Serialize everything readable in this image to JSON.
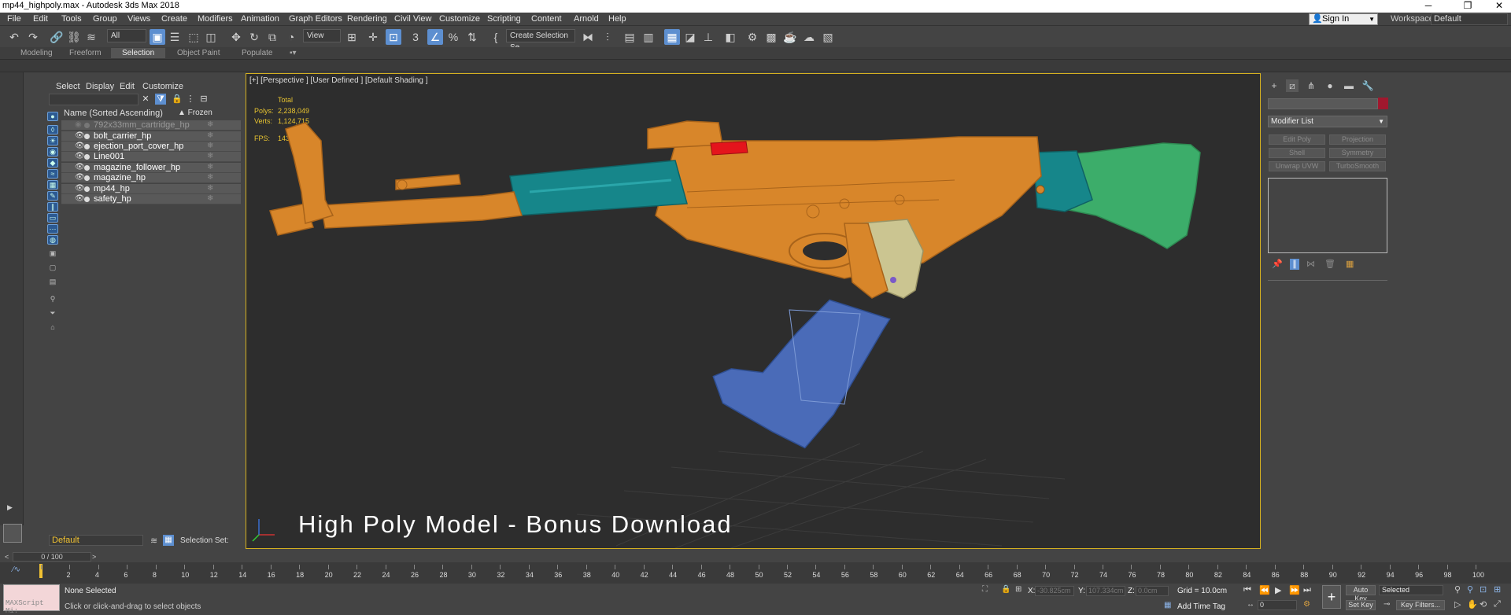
{
  "app": {
    "window_title": "mp44_highpoly.max - Autodesk 3ds Max 2018",
    "window_buttons": [
      "─",
      "❐",
      "✕"
    ]
  },
  "menus": [
    "File",
    "Edit",
    "Tools",
    "Group",
    "Views",
    "Create",
    "Modifiers",
    "Animation",
    "Graph Editors",
    "Rendering",
    "Civil View",
    "Customize",
    "Scripting",
    "Content",
    "Arnold",
    "Help"
  ],
  "account": {
    "sign_in": "Sign In",
    "workspaces_label": "Workspaces:",
    "workspace": "Default"
  },
  "toolbar": {
    "filter": "All",
    "ref_coord": "View",
    "selection_set": "Create Selection Se"
  },
  "ribbon_tabs": [
    "Modeling",
    "Freeform",
    "Selection",
    "Object Paint",
    "Populate"
  ],
  "scene_explorer": {
    "menus": [
      "Select",
      "Display",
      "Edit",
      "Customize"
    ],
    "col_name": "Name (Sorted Ascending)",
    "col_frozen": "▲ Frozen",
    "rows": [
      {
        "name": "792x33mm_cartridge_hp",
        "hidden": true
      },
      {
        "name": "bolt_carrier_hp",
        "hidden": false
      },
      {
        "name": "ejection_port_cover_hp",
        "hidden": false
      },
      {
        "name": "Line001",
        "hidden": false
      },
      {
        "name": "magazine_follower_hp",
        "hidden": false
      },
      {
        "name": "magazine_hp",
        "hidden": false
      },
      {
        "name": "mp44_hp",
        "hidden": false
      },
      {
        "name": "safety_hp",
        "hidden": false
      }
    ],
    "layer": "Default",
    "selection_set_label": "Selection Set:"
  },
  "viewport": {
    "label": "[+] [Perspective ] [User Defined ] [Default Shading ]",
    "stats_total": "Total",
    "polys_label": "Polys:",
    "polys": "2,238,049",
    "verts_label": "Verts:",
    "verts": "1,124,715",
    "fps_label": "FPS:",
    "fps": "143.036",
    "caption": "High Poly Model - Bonus Download",
    "colors": {
      "body": "#d8862a",
      "teal": "#16868a",
      "stock": "#3cad6a",
      "magazine": "#4a6bb8",
      "grip": "#cbc591",
      "red": "#e4141c"
    }
  },
  "command_panel": {
    "modifier_list": "Modifier List",
    "buttons": [
      "Edit Poly",
      "Projection",
      "Shell",
      "Symmetry",
      "Unwrap UVW",
      "TurboSmooth"
    ]
  },
  "timeline": {
    "slider": "0 / 100",
    "ticks": [
      "0",
      "2",
      "4",
      "6",
      "8",
      "10",
      "12",
      "14",
      "16",
      "18",
      "20",
      "22",
      "24",
      "26",
      "28",
      "30",
      "32",
      "34",
      "36",
      "38",
      "40",
      "42",
      "44",
      "46",
      "48",
      "50",
      "52",
      "54",
      "56",
      "58",
      "60",
      "62",
      "64",
      "66",
      "68",
      "70",
      "72",
      "74",
      "76",
      "78",
      "80",
      "82",
      "84",
      "86",
      "88",
      "90",
      "92",
      "94",
      "96",
      "98",
      "100"
    ]
  },
  "status": {
    "maxscript": "MAXScript Mi:",
    "selection": "None Selected",
    "prompt": "Click or click-and-drag to select objects",
    "x_label": "X:",
    "x": "-30.825cm",
    "y_label": "Y:",
    "y": "107.334cm",
    "z_label": "Z:",
    "z": "0.0cm",
    "grid": "Grid = 10.0cm",
    "add_time_tag": "Add Time Tag",
    "auto_key": "Auto Key",
    "set_key": "Set Key",
    "key_mode": "Selected",
    "key_filters": "Key Filters...",
    "frame": "0"
  }
}
